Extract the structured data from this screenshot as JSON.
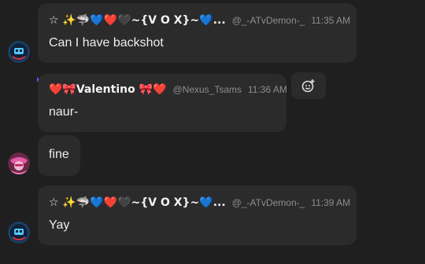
{
  "messages": [
    {
      "author": "☆ ✨🦈💙❤️🖤~{V O X}~💙...",
      "handle": "@_-ATvDemon-_",
      "time": "11:35 AM",
      "text": "Can I have backshot",
      "avatar_icon": "vox-avatar-icon"
    },
    {
      "author": "❤️🎀Valentino 🎀❤️",
      "handle": "@Nexus_Tsams",
      "time": "11:36 AM",
      "text": "naur-",
      "badge_icon": "crown-icon"
    },
    {
      "text": "fine",
      "avatar_icon": "valentino-avatar-icon"
    },
    {
      "author": "☆ ✨🦈💙❤️🖤~{V O X}~💙...",
      "handle": "@_-ATvDemon-_",
      "time": "11:39 AM",
      "text": "Yay",
      "avatar_icon": "vox-avatar-icon"
    }
  ],
  "actions": {
    "add_reaction_icon": "add-reaction-icon"
  },
  "colors": {
    "background": "#1f1f1f",
    "bubble": "#2b2b2b",
    "text": "#ededed",
    "muted": "#8e8e8e",
    "crown": "#7c4dff"
  }
}
